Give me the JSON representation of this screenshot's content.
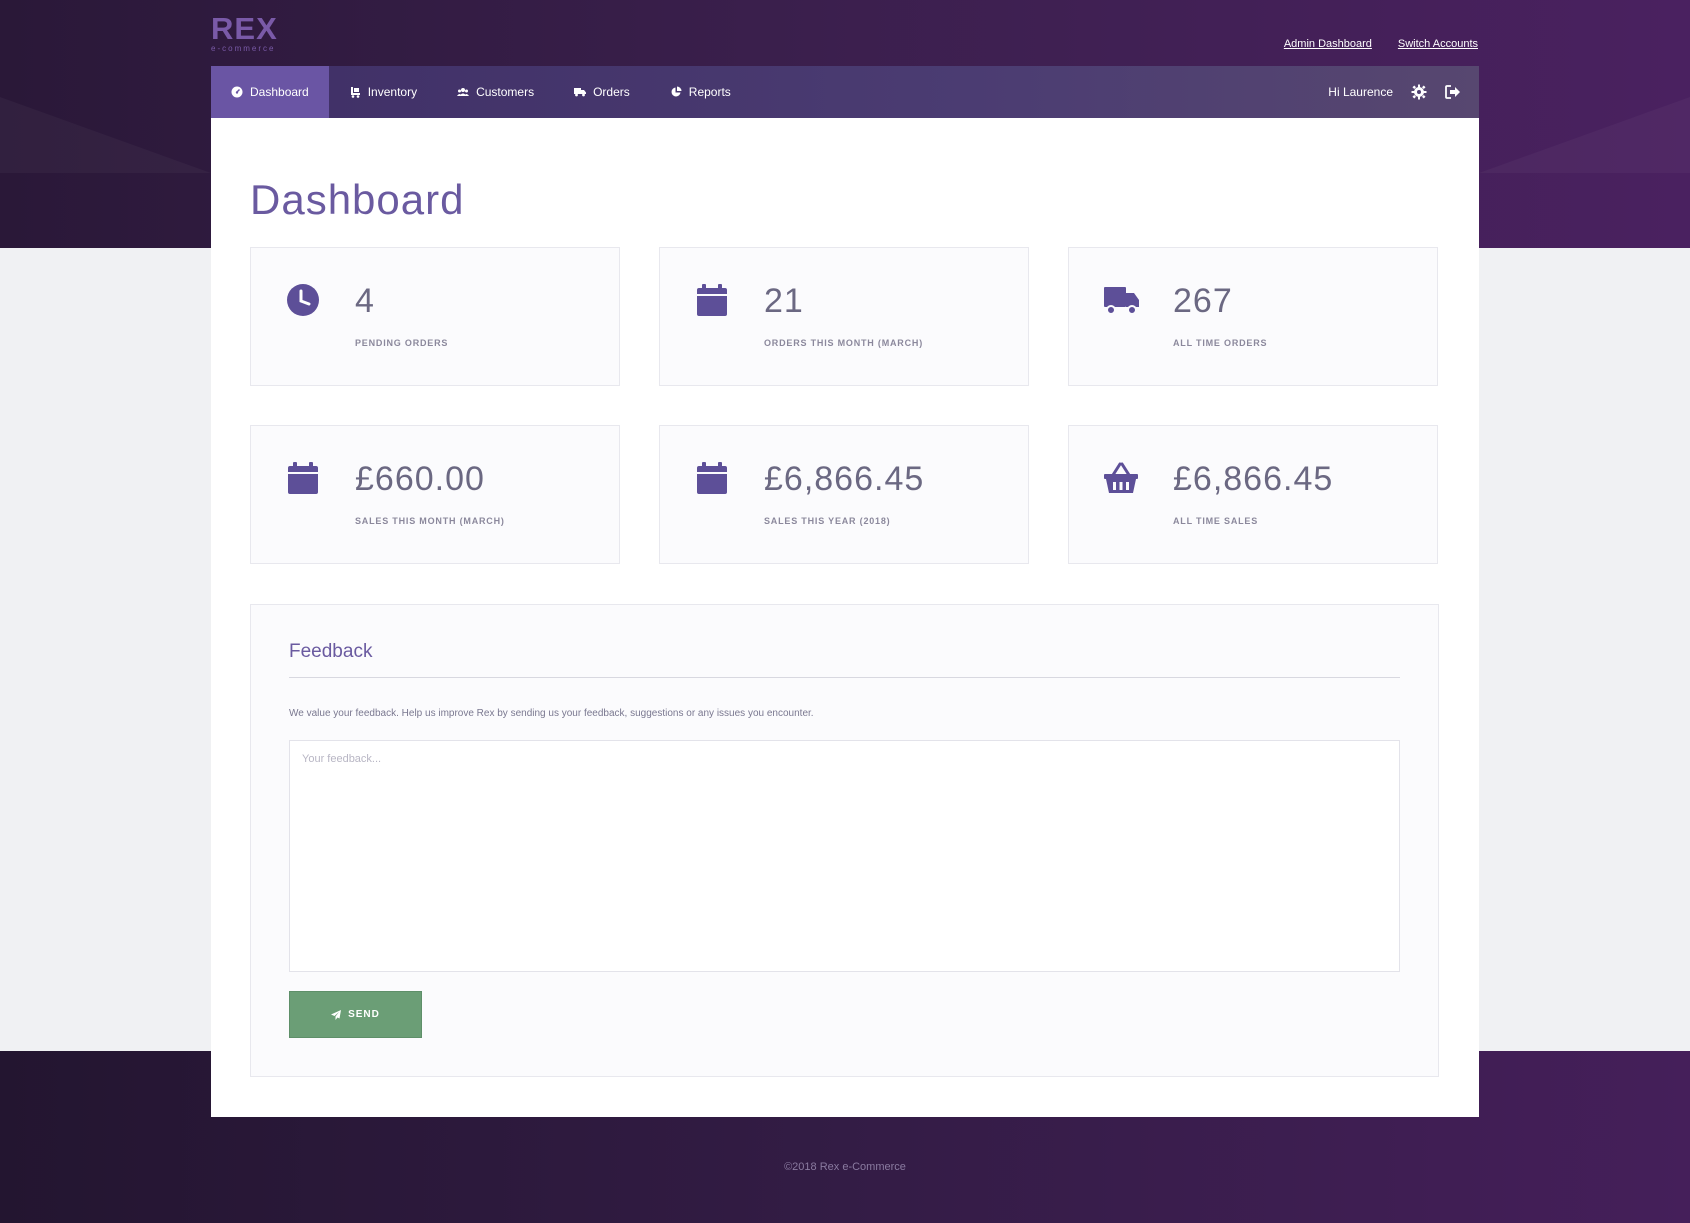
{
  "app": {
    "logo": "REX",
    "logo_sub": "e-commerce"
  },
  "top_links": {
    "admin": "Admin Dashboard",
    "switch": "Switch Accounts"
  },
  "nav": {
    "items": [
      {
        "label": "Dashboard",
        "icon": "dashboard-icon",
        "active": true
      },
      {
        "label": "Inventory",
        "icon": "inventory-icon"
      },
      {
        "label": "Customers",
        "icon": "customers-icon"
      },
      {
        "label": "Orders",
        "icon": "truck-icon"
      },
      {
        "label": "Reports",
        "icon": "pie-chart-icon"
      }
    ],
    "greeting": "Hi Laurence"
  },
  "page": {
    "title": "Dashboard"
  },
  "stats": [
    {
      "value": "4",
      "label": "PENDING ORDERS",
      "icon": "clock-icon"
    },
    {
      "value": "21",
      "label": "ORDERS THIS MONTH (MARCH)",
      "icon": "calendar-icon"
    },
    {
      "value": "267",
      "label": "ALL TIME ORDERS",
      "icon": "truck-icon"
    },
    {
      "value": "£660.00",
      "label": "SALES THIS MONTH (MARCH)",
      "icon": "calendar-icon"
    },
    {
      "value": "£6,866.45",
      "label": "SALES THIS YEAR (2018)",
      "icon": "calendar-icon"
    },
    {
      "value": "£6,866.45",
      "label": "ALL TIME SALES",
      "icon": "basket-icon"
    }
  ],
  "feedback": {
    "title": "Feedback",
    "text": "We value your feedback. Help us improve Rex by sending us your feedback, suggestions or any issues you encounter.",
    "placeholder": "Your feedback...",
    "send_label": "SEND"
  },
  "footer": {
    "text": "©2018 Rex e-Commerce"
  },
  "colors": {
    "accent": "#6a55a4",
    "icon": "#5d4f98",
    "send": "#6b9e76"
  }
}
